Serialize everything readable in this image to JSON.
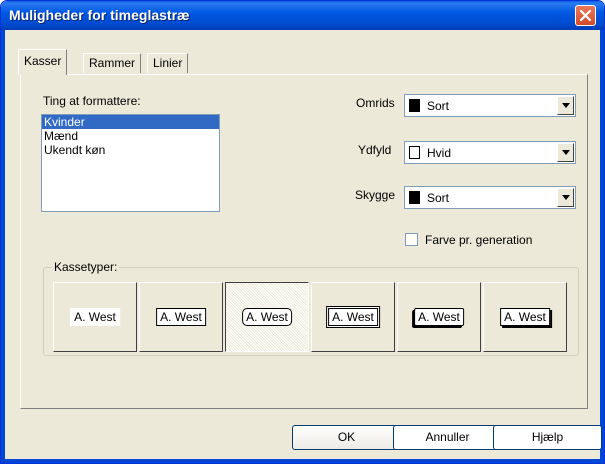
{
  "window": {
    "title": "Muligheder for timeglastræ"
  },
  "tabs": [
    {
      "label": "Kasser",
      "active": true
    },
    {
      "label": "Rammer",
      "active": false
    },
    {
      "label": "Linier",
      "active": false
    }
  ],
  "format_list": {
    "label": "Ting at formattere:",
    "items": [
      {
        "label": "Kvinder",
        "selected": true
      },
      {
        "label": "Mænd",
        "selected": false
      },
      {
        "label": "Ukendt køn",
        "selected": false
      }
    ]
  },
  "outline": {
    "label": "Omrids",
    "value": "Sort",
    "swatch": "#000000"
  },
  "fill": {
    "label": "Ydfyld",
    "value": "Hvid",
    "swatch": "#ffffff"
  },
  "shadow": {
    "label": "Skygge",
    "value": "Sort",
    "swatch": "#000000"
  },
  "color_per_generation": {
    "label": "Farve pr. generation",
    "checked": false
  },
  "box_types": {
    "label": "Kassetyper:",
    "sample_text": "A. West",
    "selected_index": 2
  },
  "buttons": {
    "ok": "OK",
    "cancel": "Annuller",
    "help": "Hjælp"
  },
  "colors": {
    "title_bar": "#0058e3",
    "selection": "#316ac5",
    "dialog": "#ece9d8"
  }
}
